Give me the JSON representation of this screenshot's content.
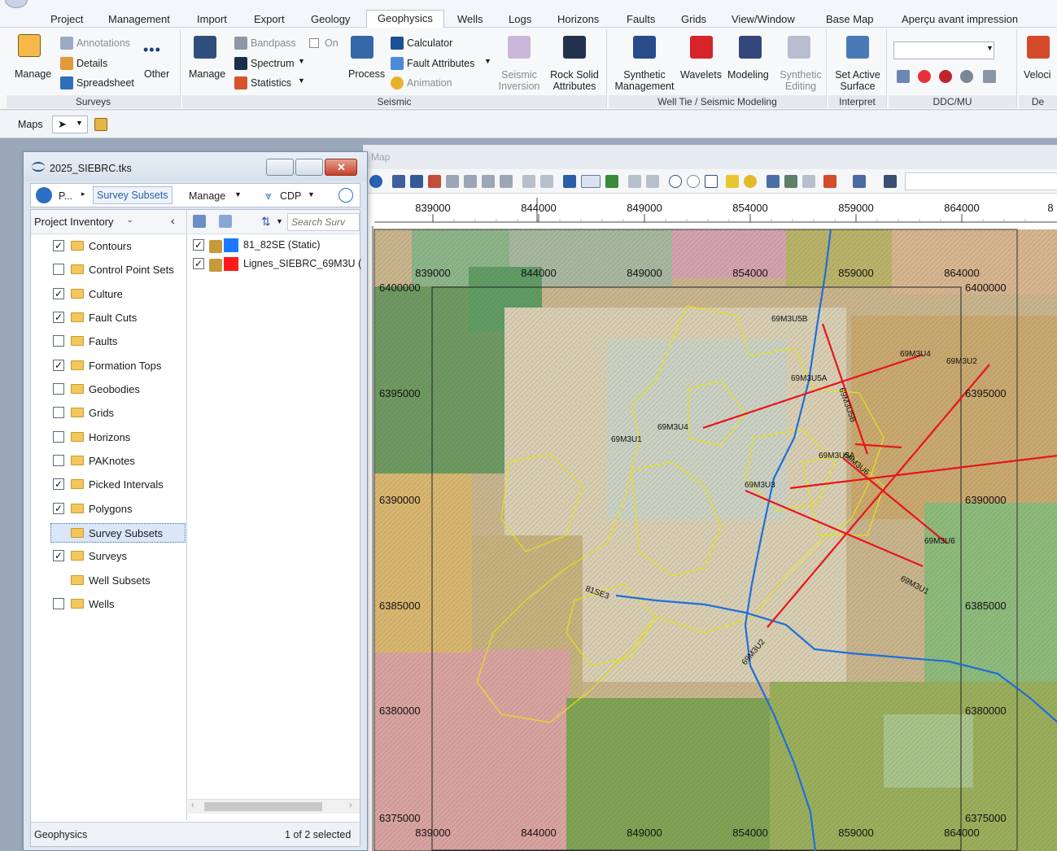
{
  "menu": {
    "tabs": [
      "Project",
      "Management",
      "Import",
      "Export",
      "Geology",
      "Geophysics",
      "Wells",
      "Logs",
      "Horizons",
      "Faults",
      "Grids",
      "View/Window",
      "Base Map",
      "Aperçu avant impression"
    ],
    "active_tab": "Geophysics"
  },
  "ribbon": {
    "surveys": {
      "label": "Surveys",
      "manage": "Manage",
      "annotations": "Annotations",
      "details": "Details",
      "spreadsheet": "Spreadsheet",
      "other": "Other"
    },
    "seismic": {
      "label": "Seismic",
      "manage": "Manage",
      "bandpass": "Bandpass",
      "on": "On",
      "spectrum": "Spectrum",
      "statistics": "Statistics",
      "process": "Process",
      "calculator": "Calculator",
      "fault_attributes": "Fault Attributes",
      "animation": "Animation",
      "seismic_inversion_1": "Seismic",
      "seismic_inversion_2": "Inversion",
      "rock_solid_1": "Rock Solid",
      "rock_solid_2": "Attributes"
    },
    "welltie": {
      "label": "Well Tie / Seismic Modeling",
      "synthetic_mgmt_1": "Synthetic",
      "synthetic_mgmt_2": "Management",
      "wavelets": "Wavelets",
      "modeling": "Modeling",
      "synthetic_edit_1": "Synthetic",
      "synthetic_edit_2": "Editing"
    },
    "interpret": {
      "label": "Interpret",
      "set_active_1": "Set Active",
      "set_active_2": "Surface"
    },
    "ddc": {
      "label": "DDC/MU"
    },
    "de": {
      "label": "De",
      "veloci": "Veloci"
    }
  },
  "maps_toolbar": {
    "label": "Maps"
  },
  "inventory": {
    "title": "2025_SIEBRC.tks",
    "nav": {
      "breadcrumb_short": "P...",
      "breadcrumb_current": "Survey Subsets",
      "manage": "Manage",
      "cdp": "CDP"
    },
    "pane_header": "Project Inventory",
    "search_placeholder": "Search Surv",
    "tree": [
      {
        "label": "Contours",
        "checked": true
      },
      {
        "label": "Control Point Sets",
        "checked": false
      },
      {
        "label": "Culture",
        "checked": true
      },
      {
        "label": "Fault Cuts",
        "checked": true
      },
      {
        "label": "Faults",
        "checked": false
      },
      {
        "label": "Formation Tops",
        "checked": true
      },
      {
        "label": "Geobodies",
        "checked": false
      },
      {
        "label": "Grids",
        "checked": false
      },
      {
        "label": "Horizons",
        "checked": false
      },
      {
        "label": "PAKnotes",
        "checked": false
      },
      {
        "label": "Picked Intervals",
        "checked": true
      },
      {
        "label": "Polygons",
        "checked": true
      },
      {
        "label": "Survey Subsets",
        "checked": null
      },
      {
        "label": "Surveys",
        "checked": true
      },
      {
        "label": "Well Subsets",
        "checked": null
      },
      {
        "label": "Wells",
        "checked": false
      }
    ],
    "layers": [
      {
        "label": "81_82SE (Static)",
        "color": "#1e78ff",
        "checked": true
      },
      {
        "label": "Lignes_SIEBRC_69M3U (",
        "color": "#ff1a1a",
        "checked": true
      }
    ],
    "status_left": "Geophysics",
    "status_right": "1 of 2 selected"
  },
  "map": {
    "title": "Map",
    "x_ticks": [
      "839000",
      "844000",
      "849000",
      "854000",
      "859000",
      "864000"
    ],
    "y_ticks": [
      "6400000",
      "6395000",
      "6390000",
      "6385000",
      "6380000",
      "6375000"
    ],
    "ruler_partial": "8",
    "lines": [
      {
        "name": "69M3U5B"
      },
      {
        "name": "69M3U4"
      },
      {
        "name": "69M3U2"
      },
      {
        "name": "69M3U5A"
      },
      {
        "name": "69M3U1"
      },
      {
        "name": "69M3U3"
      },
      {
        "name": "69M3U6"
      },
      {
        "name": "81SE3"
      },
      {
        "name": "69M3U2"
      },
      {
        "name": "69M3U1"
      },
      {
        "name": "69M3U5A"
      },
      {
        "name": "69M3U5B"
      },
      {
        "name": "69M3U6"
      }
    ],
    "colors": {
      "seismic_line": "#e8141c",
      "survey_line": "#1e6fdc",
      "polygon": "#e6e01a"
    }
  }
}
